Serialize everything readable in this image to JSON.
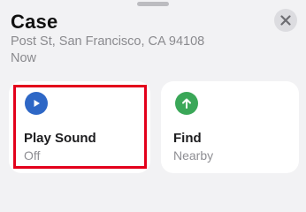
{
  "header": {
    "title": "Case",
    "address": "Post St, San Francisco, CA 94108",
    "timestamp": "Now",
    "close_icon": "close-icon"
  },
  "actions": [
    {
      "label": "Play Sound",
      "status": "Off",
      "icon": "play-icon",
      "icon_color": "#2e67c6"
    },
    {
      "label": "Find",
      "status": "Nearby",
      "icon": "arrow-up-icon",
      "icon_color": "#3aa758"
    }
  ],
  "colors": {
    "highlight": "#e3001b",
    "background": "#f2f2f4",
    "card": "#ffffff"
  }
}
